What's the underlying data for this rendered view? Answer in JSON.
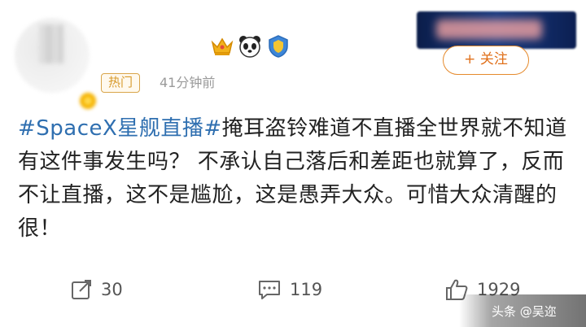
{
  "author": {
    "name": "",
    "icons": [
      "crown-icon",
      "panda-icon",
      "shield-icon"
    ],
    "badge_color": "#f5b300"
  },
  "post_meta": {
    "hot_label": "热门",
    "time": "41分钟前"
  },
  "follow_label": "+ 关注",
  "post": {
    "topic": "#SpaceX星舰直播#",
    "body": "掩耳盗铃难道不直播全世界就不知道有这件事发生吗？ 不承认自己落后和差距也就算了，反而不让直播，这不是尴尬，这是愚弄大众。可惜大众清醒的很！"
  },
  "actions": {
    "share_count": "30",
    "comment_count": "119",
    "like_count": "1929"
  },
  "watermark": "头条 @吴迩",
  "colors": {
    "topic": "#2f6fb0",
    "accent": "#e0701b",
    "hot": "#d79a2c"
  }
}
